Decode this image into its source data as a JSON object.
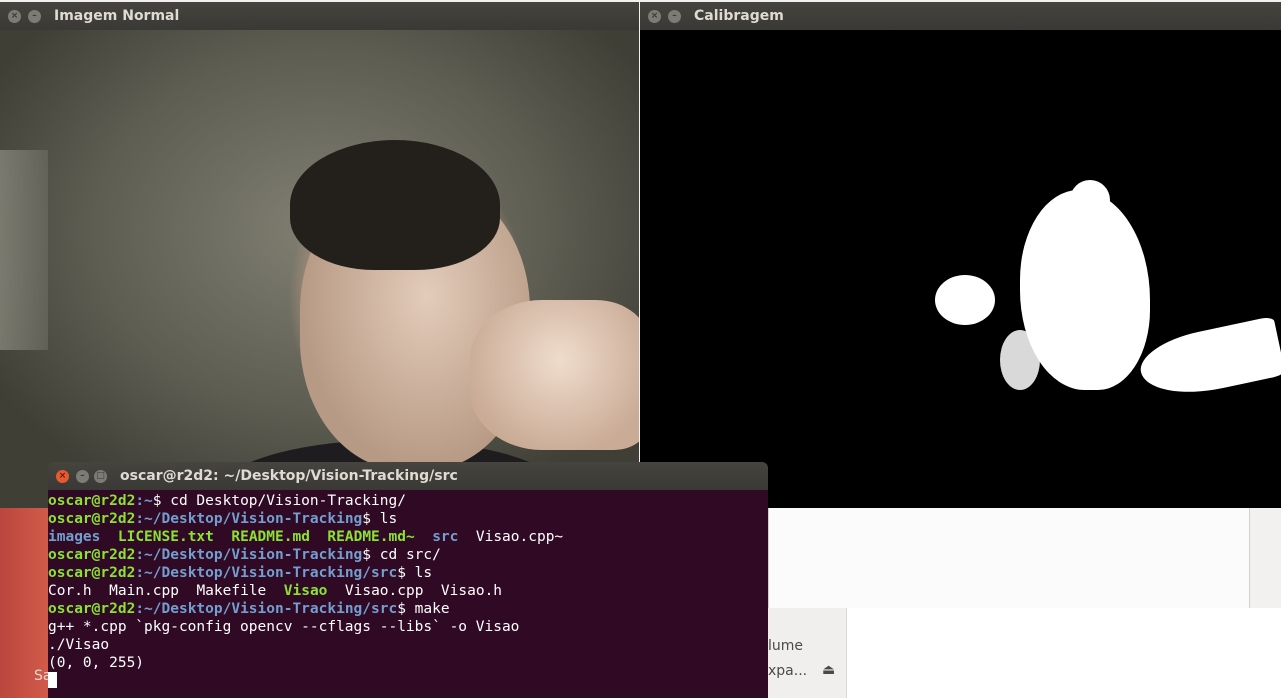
{
  "windows": {
    "normal": {
      "title": "Imagem Normal"
    },
    "calib": {
      "title": "Calibragem"
    },
    "terminal": {
      "title": "oscar@r2d2: ~/Desktop/Vision-Tracking/src"
    }
  },
  "background": {
    "panel_volume": "lume",
    "panel_expand": "xpa...",
    "eject_icon": "eject-icon",
    "left_text": "Sa"
  },
  "terminal": {
    "user": "oscar@r2d2",
    "lines": [
      {
        "path": ":~",
        "cmd": "$ cd Desktop/Vision-Tracking/"
      },
      {
        "path": ":~/Desktop/Vision-Tracking",
        "cmd": "$ ls"
      },
      {
        "path": ":~/Desktop/Vision-Tracking",
        "cmd": "$ cd src/"
      },
      {
        "path": ":~/Desktop/Vision-Tracking/src",
        "cmd": "$ ls"
      },
      {
        "path": ":~/Desktop/Vision-Tracking/src",
        "cmd": "$ make"
      }
    ],
    "ls1": {
      "images": "images",
      "license": "LICENSE.txt",
      "readme": "README.md",
      "readme_bak": "README.md~",
      "src": "src",
      "visao_bak": "Visao.cpp~"
    },
    "ls2": {
      "cor": "Cor.h",
      "main": "Main.cpp",
      "makefile": "Makefile",
      "visao": "Visao",
      "visao_cpp": "Visao.cpp",
      "visao_h": "Visao.h"
    },
    "make_output": "g++ *.cpp `pkg-config opencv --cflags --libs` -o Visao",
    "run_cmd": "./Visao",
    "run_output": "(0, 0, 255)"
  }
}
